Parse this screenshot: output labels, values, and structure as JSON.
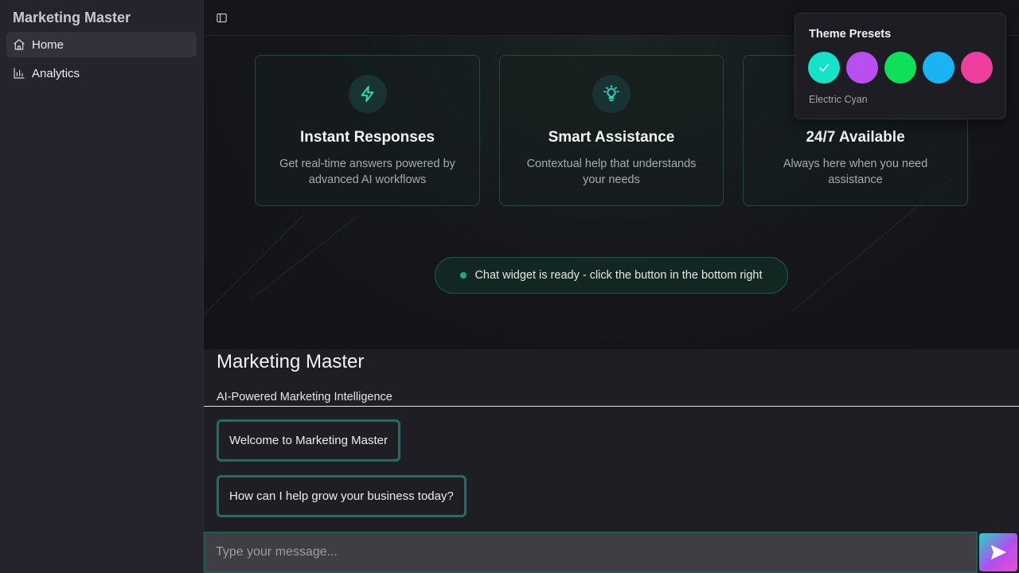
{
  "sidebar": {
    "brand": "Marketing Master",
    "items": [
      {
        "label": "Home",
        "icon": "home-icon",
        "active": true
      },
      {
        "label": "Analytics",
        "icon": "bar-chart-icon",
        "active": false
      }
    ]
  },
  "features": [
    {
      "title": "Instant Responses",
      "desc": "Get real-time answers powered by advanced AI workflows",
      "icon": "lightning-icon"
    },
    {
      "title": "Smart Assistance",
      "desc": "Contextual help that understands your needs",
      "icon": "lightbulb-icon"
    },
    {
      "title": "24/7 Available",
      "desc": "Always here when you need assistance",
      "icon": "clock-icon"
    }
  ],
  "status": {
    "text": "Chat widget is ready - click the button in the bottom right"
  },
  "chat": {
    "title": "Marketing Master",
    "subtitle": "AI-Powered Marketing Intelligence",
    "messages": [
      "Welcome to Marketing Master",
      "How can I help grow your business today?"
    ],
    "input_placeholder": "Type your message..."
  },
  "theme": {
    "title": "Theme Presets",
    "selected_name": "Electric Cyan",
    "swatches": [
      {
        "color": "#14e3c9",
        "selected": true
      },
      {
        "color": "#b94ff0",
        "selected": false
      },
      {
        "color": "#0fe05a",
        "selected": false
      },
      {
        "color": "#1ab4f5",
        "selected": false
      },
      {
        "color": "#ee3f9e",
        "selected": false
      }
    ]
  },
  "colors": {
    "accent": "#26e3c2",
    "card_border": "#1f4a41",
    "bubble_border": "#2a6a63"
  }
}
